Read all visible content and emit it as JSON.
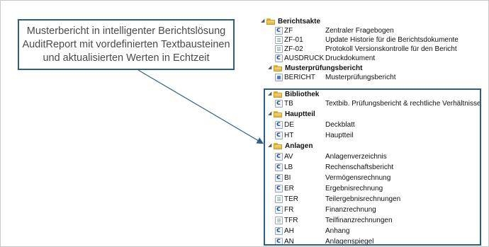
{
  "callout": {
    "lines": [
      "Musterbericht in intelligenter Berichtslösung",
      "AuditReport mit vordefinierten Textbausteinen",
      "und aktualisierten Werten in Echtzeit"
    ]
  },
  "tree": {
    "berichtsakte": {
      "label": "Berichtsakte",
      "items": [
        {
          "code": "ZF",
          "desc": "Zentraler Fragebogen",
          "icon": "c-doc-icon"
        },
        {
          "code": "ZF-01",
          "desc": "Update Historie für die Berichtsdokumente",
          "icon": "blank-doc-icon"
        },
        {
          "code": "ZF-02",
          "desc": "Protokoll Versionskontrolle für den Bericht",
          "icon": "blank-doc-icon"
        },
        {
          "code": "AUSDRUCK",
          "desc": "Druckdokument",
          "icon": "c-doc-icon"
        }
      ]
    },
    "musterpruefungsbericht": {
      "label": "Musterprüfungsbericht",
      "items": [
        {
          "code": "BERICHT",
          "desc": "Musterprüfungsbericht",
          "icon": "report-doc-icon"
        }
      ]
    },
    "bibliothek": {
      "label": "Bibliothek",
      "items": [
        {
          "code": "TB",
          "desc": "Textbib. Prüfungsbericht & rechtliche Verhältnisse",
          "icon": "c-doc-icon"
        }
      ]
    },
    "hauptteil": {
      "label": "Hauptteil",
      "items": [
        {
          "code": "DE",
          "desc": "Deckblatt",
          "icon": "c-doc-icon"
        },
        {
          "code": "HT",
          "desc": "Hauptteil",
          "icon": "c-doc-icon"
        }
      ]
    },
    "anlagen": {
      "label": "Anlagen",
      "items": [
        {
          "code": "AV",
          "desc": "Anlagenverzeichnis",
          "icon": "c-doc-icon"
        },
        {
          "code": "LB",
          "desc": "Rechenschaftsbericht",
          "icon": "c-doc-icon"
        },
        {
          "code": "BI",
          "desc": "Vermögensrechnung",
          "icon": "c-doc-icon"
        },
        {
          "code": "ER",
          "desc": "Ergebnisrechnung",
          "icon": "c-doc-icon"
        },
        {
          "code": "TER",
          "desc": "Teilergebnisrechnungen",
          "icon": "blank-doc-icon"
        },
        {
          "code": "FR",
          "desc": "Finanzrechnung",
          "icon": "c-doc-icon"
        },
        {
          "code": "TFR",
          "desc": "Teilfinanzrechnungen",
          "icon": "blank-doc-icon"
        },
        {
          "code": "AH",
          "desc": "Anhang",
          "icon": "c-doc-icon"
        },
        {
          "code": "AN",
          "desc": "Anlagenspiegel",
          "icon": "c-doc-icon"
        }
      ]
    }
  },
  "colors": {
    "accent": "#2d5f86",
    "folder": "#f2c94c",
    "text": "#111111"
  }
}
